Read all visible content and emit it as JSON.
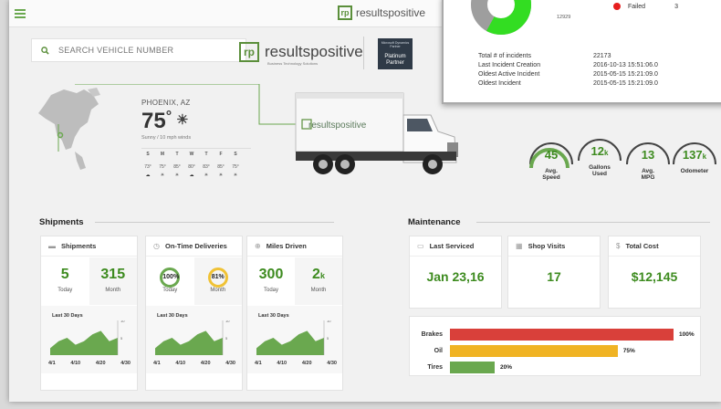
{
  "header": {
    "brand": "resultspositive"
  },
  "search": {
    "placeholder": "SEARCH VEHICLE NUMBER"
  },
  "brand": {
    "name": "resultspositive",
    "tagline": "Business Technology Solutions",
    "partner_line1": "Microsoft Dynamics Partner",
    "partner_line2": "Platinum",
    "partner_line3": "Partner"
  },
  "weather": {
    "city": "PHOENIX, AZ",
    "temp": "75",
    "desc": "Sunny / 10 mph winds",
    "days": [
      {
        "d": "S",
        "t": "73°",
        "i": "☁"
      },
      {
        "d": "M",
        "t": "75°",
        "i": "☀"
      },
      {
        "d": "T",
        "t": "85°",
        "i": "☀"
      },
      {
        "d": "W",
        "t": "80°",
        "i": "☁"
      },
      {
        "d": "T",
        "t": "83°",
        "i": "☀"
      },
      {
        "d": "F",
        "t": "85°",
        "i": "☀"
      },
      {
        "d": "S",
        "t": "75°",
        "i": "☀"
      }
    ]
  },
  "truck": {
    "brand": "resultspositive"
  },
  "popup": {
    "donut_label": "12929",
    "donut_share_failed_fraction": 0.42,
    "legend": {
      "label": "Failed",
      "value": "3"
    },
    "rows": [
      {
        "k": "Total # of incidents",
        "v": "22173"
      },
      {
        "k": "Last Incident Creation",
        "v": "2016-10-13 15:51:06.0"
      },
      {
        "k": "Oldest Active Incident",
        "v": "2015-05-15 15:21:09.0"
      },
      {
        "k": "Oldest Incident",
        "v": "2015-05-15 15:21:09.0"
      }
    ]
  },
  "gauges": [
    {
      "value": "45",
      "suffix": "",
      "label1": "Avg.",
      "label2": "Speed"
    },
    {
      "value": "12",
      "suffix": "k",
      "label1": "Gallons",
      "label2": "Used"
    },
    {
      "value": "13",
      "suffix": "",
      "label1": "Avg.",
      "label2": "MPG"
    },
    {
      "value": "137",
      "suffix": "k",
      "label1": "Odometer",
      "label2": ""
    }
  ],
  "sections": {
    "shipments": "Shipments",
    "maintenance": "Maintenance"
  },
  "cards": {
    "shipments": {
      "title": "Shipments",
      "today": "5",
      "month": "315"
    },
    "ontime": {
      "title": "On-Time Deliveries",
      "today": "100",
      "month": "81",
      "unit": "%"
    },
    "miles": {
      "title": "Miles Driven",
      "today": "300",
      "month": "2",
      "month_suffix": "k"
    },
    "captions": {
      "today": "Today",
      "month": "Month",
      "last30": "Last 30 Days"
    },
    "spark_ticks": [
      "4/1",
      "4/10",
      "4/20",
      "4/30"
    ],
    "spark_yticks": [
      "10",
      "5"
    ],
    "spark_values": [
      2,
      4,
      5,
      3,
      4,
      6,
      7,
      4,
      5
    ]
  },
  "maintenance": {
    "last_serviced": {
      "title": "Last Serviced",
      "value": "Jan 23,16"
    },
    "shop_visits": {
      "title": "Shop Visits",
      "value": "17"
    },
    "total_cost": {
      "title": "Total Cost",
      "value": "$12,145"
    },
    "bars": [
      {
        "label": "Brakes",
        "pct": 100,
        "text": "100%",
        "color": "#d9403a"
      },
      {
        "label": "Oil",
        "pct": 75,
        "text": "75%",
        "color": "#f0b323"
      },
      {
        "label": "Tires",
        "pct": 20,
        "text": "20%",
        "color": "#6aa84f"
      }
    ]
  },
  "colors": {
    "accent": "#3d8b1f",
    "donut_green": "#33dd22",
    "donut_gray": "#9e9e9e"
  }
}
